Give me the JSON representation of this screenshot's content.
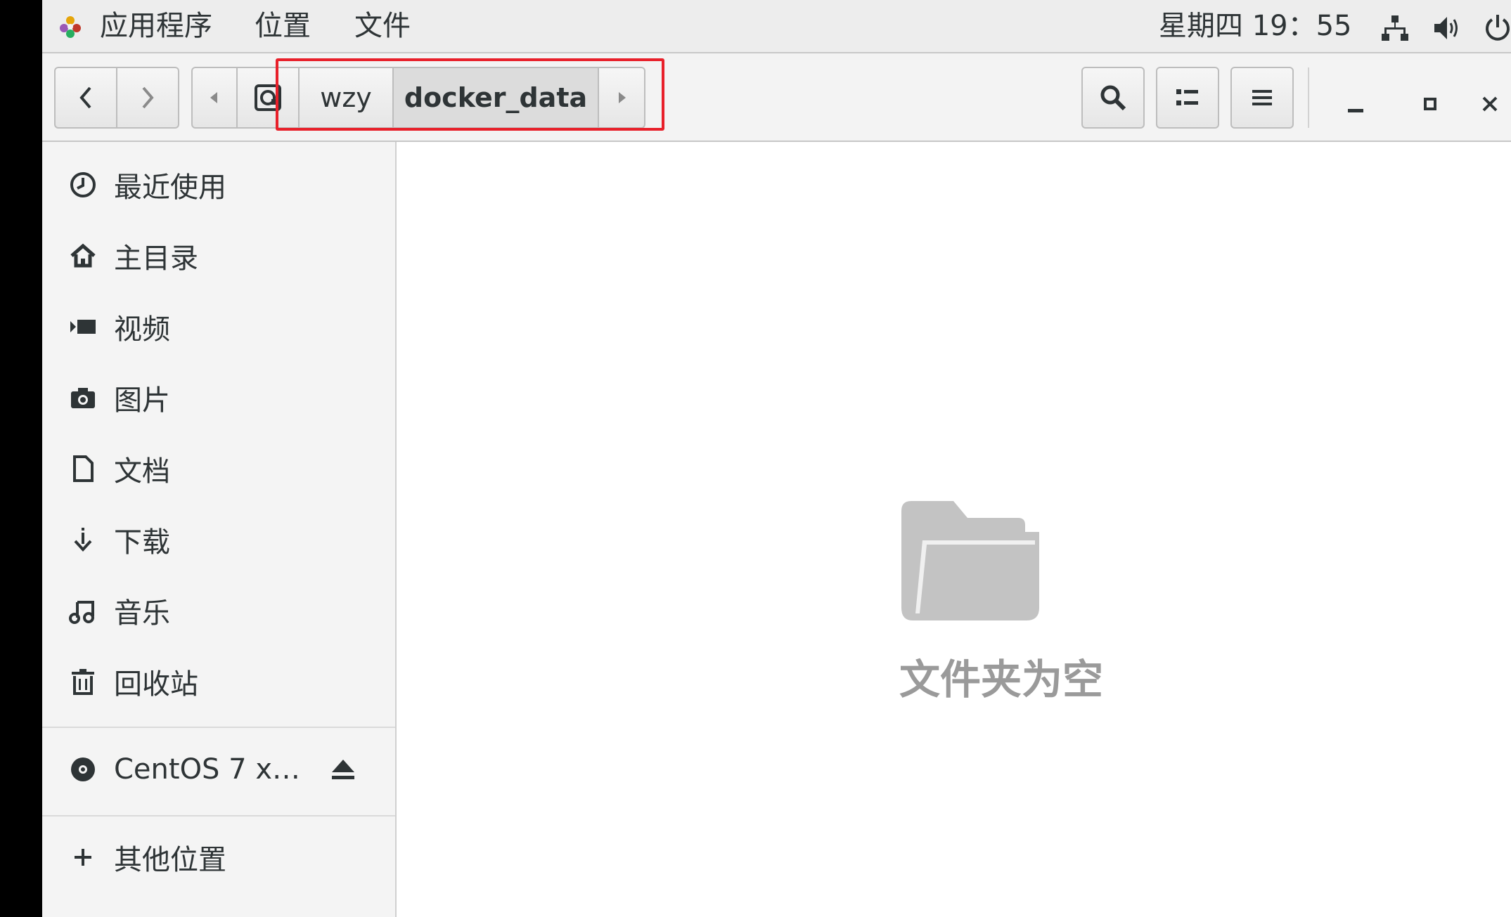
{
  "top_panel": {
    "apps_label": "应用程序",
    "places_label": "位置",
    "files_label": "文件",
    "clock": "星期四 19：55",
    "icons": [
      "network-icon",
      "volume-icon",
      "power-icon"
    ]
  },
  "headerbar": {
    "breadcrumbs": [
      "wzy",
      "docker_data"
    ],
    "active_crumb": "docker_data",
    "icons": [
      "back-icon",
      "forward-icon",
      "crumb-left-icon",
      "home-drive-icon",
      "crumb-right-icon",
      "search-icon",
      "view-list-icon",
      "menu-icon",
      "minimize-icon",
      "maximize-icon",
      "close-icon"
    ]
  },
  "sidebar": {
    "items": [
      {
        "label": "最近使用",
        "icon": "recent-icon"
      },
      {
        "label": "主目录",
        "icon": "home-icon"
      },
      {
        "label": "视频",
        "icon": "video-icon"
      },
      {
        "label": "图片",
        "icon": "camera-icon"
      },
      {
        "label": "文档",
        "icon": "document-icon"
      },
      {
        "label": "下载",
        "icon": "download-icon"
      },
      {
        "label": "音乐",
        "icon": "music-icon"
      },
      {
        "label": "回收站",
        "icon": "trash-icon"
      }
    ],
    "device": {
      "label": "CentOS 7 x…",
      "icon": "disc-icon",
      "eject_icon": "eject-icon"
    },
    "other_locations": {
      "label": "其他位置",
      "icon": "plus-icon"
    }
  },
  "main": {
    "empty_message": "文件夹为空",
    "empty_icon": "folder-icon"
  },
  "colors": {
    "highlight": "#e8202a",
    "panel_bg": "#ededed",
    "sidebar_bg": "#f4f4f4",
    "folder_gray": "#c3c3c3"
  }
}
